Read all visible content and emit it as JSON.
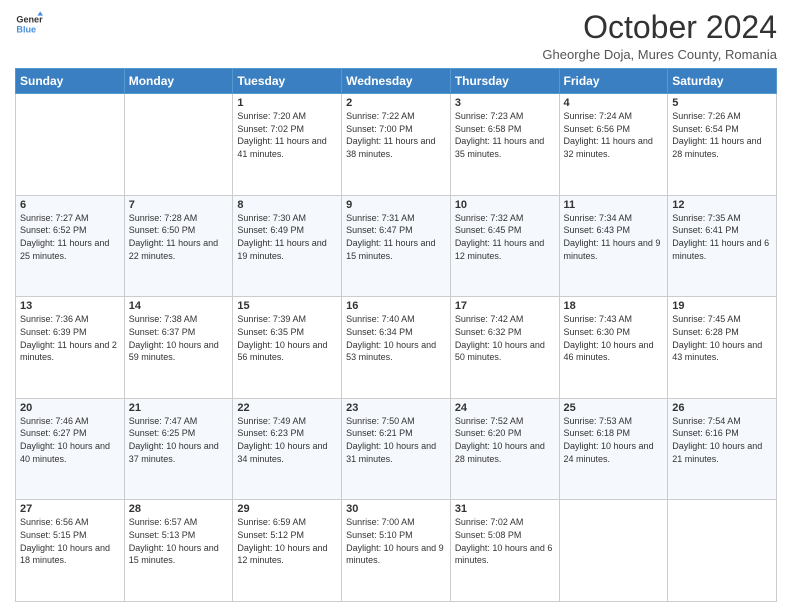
{
  "logo": {
    "line1": "General",
    "line2": "Blue"
  },
  "header": {
    "month": "October 2024",
    "location": "Gheorghe Doja, Mures County, Romania"
  },
  "days_of_week": [
    "Sunday",
    "Monday",
    "Tuesday",
    "Wednesday",
    "Thursday",
    "Friday",
    "Saturday"
  ],
  "weeks": [
    [
      {
        "day": "",
        "info": ""
      },
      {
        "day": "",
        "info": ""
      },
      {
        "day": "1",
        "info": "Sunrise: 7:20 AM\nSunset: 7:02 PM\nDaylight: 11 hours and 41 minutes."
      },
      {
        "day": "2",
        "info": "Sunrise: 7:22 AM\nSunset: 7:00 PM\nDaylight: 11 hours and 38 minutes."
      },
      {
        "day": "3",
        "info": "Sunrise: 7:23 AM\nSunset: 6:58 PM\nDaylight: 11 hours and 35 minutes."
      },
      {
        "day": "4",
        "info": "Sunrise: 7:24 AM\nSunset: 6:56 PM\nDaylight: 11 hours and 32 minutes."
      },
      {
        "day": "5",
        "info": "Sunrise: 7:26 AM\nSunset: 6:54 PM\nDaylight: 11 hours and 28 minutes."
      }
    ],
    [
      {
        "day": "6",
        "info": "Sunrise: 7:27 AM\nSunset: 6:52 PM\nDaylight: 11 hours and 25 minutes."
      },
      {
        "day": "7",
        "info": "Sunrise: 7:28 AM\nSunset: 6:50 PM\nDaylight: 11 hours and 22 minutes."
      },
      {
        "day": "8",
        "info": "Sunrise: 7:30 AM\nSunset: 6:49 PM\nDaylight: 11 hours and 19 minutes."
      },
      {
        "day": "9",
        "info": "Sunrise: 7:31 AM\nSunset: 6:47 PM\nDaylight: 11 hours and 15 minutes."
      },
      {
        "day": "10",
        "info": "Sunrise: 7:32 AM\nSunset: 6:45 PM\nDaylight: 11 hours and 12 minutes."
      },
      {
        "day": "11",
        "info": "Sunrise: 7:34 AM\nSunset: 6:43 PM\nDaylight: 11 hours and 9 minutes."
      },
      {
        "day": "12",
        "info": "Sunrise: 7:35 AM\nSunset: 6:41 PM\nDaylight: 11 hours and 6 minutes."
      }
    ],
    [
      {
        "day": "13",
        "info": "Sunrise: 7:36 AM\nSunset: 6:39 PM\nDaylight: 11 hours and 2 minutes."
      },
      {
        "day": "14",
        "info": "Sunrise: 7:38 AM\nSunset: 6:37 PM\nDaylight: 10 hours and 59 minutes."
      },
      {
        "day": "15",
        "info": "Sunrise: 7:39 AM\nSunset: 6:35 PM\nDaylight: 10 hours and 56 minutes."
      },
      {
        "day": "16",
        "info": "Sunrise: 7:40 AM\nSunset: 6:34 PM\nDaylight: 10 hours and 53 minutes."
      },
      {
        "day": "17",
        "info": "Sunrise: 7:42 AM\nSunset: 6:32 PM\nDaylight: 10 hours and 50 minutes."
      },
      {
        "day": "18",
        "info": "Sunrise: 7:43 AM\nSunset: 6:30 PM\nDaylight: 10 hours and 46 minutes."
      },
      {
        "day": "19",
        "info": "Sunrise: 7:45 AM\nSunset: 6:28 PM\nDaylight: 10 hours and 43 minutes."
      }
    ],
    [
      {
        "day": "20",
        "info": "Sunrise: 7:46 AM\nSunset: 6:27 PM\nDaylight: 10 hours and 40 minutes."
      },
      {
        "day": "21",
        "info": "Sunrise: 7:47 AM\nSunset: 6:25 PM\nDaylight: 10 hours and 37 minutes."
      },
      {
        "day": "22",
        "info": "Sunrise: 7:49 AM\nSunset: 6:23 PM\nDaylight: 10 hours and 34 minutes."
      },
      {
        "day": "23",
        "info": "Sunrise: 7:50 AM\nSunset: 6:21 PM\nDaylight: 10 hours and 31 minutes."
      },
      {
        "day": "24",
        "info": "Sunrise: 7:52 AM\nSunset: 6:20 PM\nDaylight: 10 hours and 28 minutes."
      },
      {
        "day": "25",
        "info": "Sunrise: 7:53 AM\nSunset: 6:18 PM\nDaylight: 10 hours and 24 minutes."
      },
      {
        "day": "26",
        "info": "Sunrise: 7:54 AM\nSunset: 6:16 PM\nDaylight: 10 hours and 21 minutes."
      }
    ],
    [
      {
        "day": "27",
        "info": "Sunrise: 6:56 AM\nSunset: 5:15 PM\nDaylight: 10 hours and 18 minutes."
      },
      {
        "day": "28",
        "info": "Sunrise: 6:57 AM\nSunset: 5:13 PM\nDaylight: 10 hours and 15 minutes."
      },
      {
        "day": "29",
        "info": "Sunrise: 6:59 AM\nSunset: 5:12 PM\nDaylight: 10 hours and 12 minutes."
      },
      {
        "day": "30",
        "info": "Sunrise: 7:00 AM\nSunset: 5:10 PM\nDaylight: 10 hours and 9 minutes."
      },
      {
        "day": "31",
        "info": "Sunrise: 7:02 AM\nSunset: 5:08 PM\nDaylight: 10 hours and 6 minutes."
      },
      {
        "day": "",
        "info": ""
      },
      {
        "day": "",
        "info": ""
      }
    ]
  ]
}
